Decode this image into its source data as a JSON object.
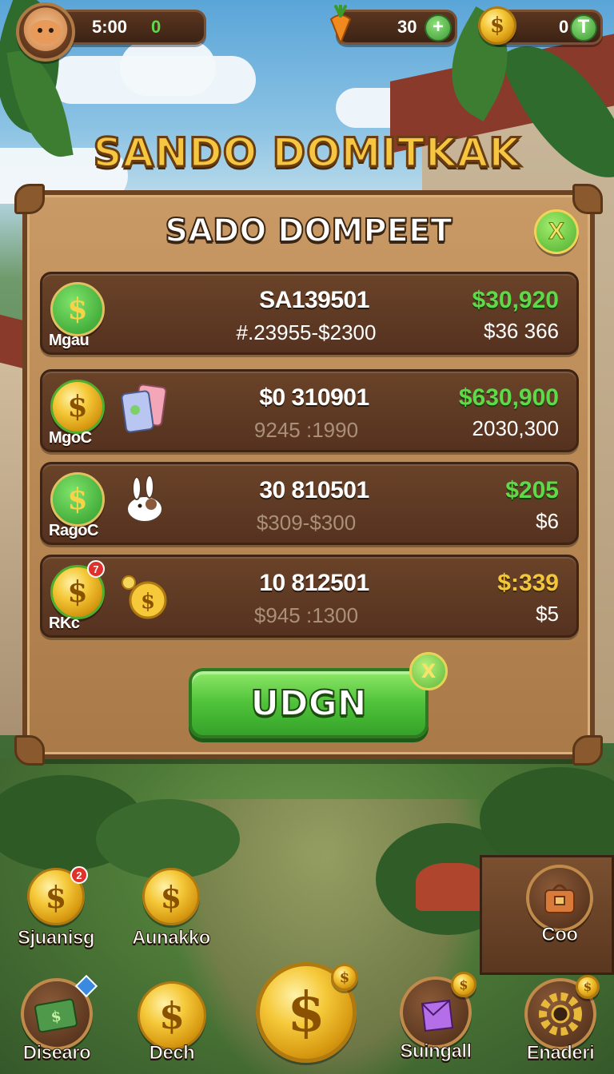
{
  "hud": {
    "timer": "5:00",
    "timer_count": "0",
    "carrots": "30",
    "coins": "0",
    "plus": "+",
    "t_plus": "T"
  },
  "title": "SANDO DOMITKAK",
  "panel": {
    "title": "SADO DOMPEET",
    "close_label": "X",
    "rows": [
      {
        "badge_symbol": "$",
        "badge_label": "Mgau",
        "code": "SA139501",
        "range": "#.23955-$2300",
        "price": "$30,920",
        "amount": "$36 366"
      },
      {
        "badge_symbol": "$",
        "badge_label": "MgoC",
        "code": "$0 310901",
        "range": "9245 :1990",
        "price": "$630,900",
        "amount": "2030,300"
      },
      {
        "badge_symbol": "$",
        "badge_label": "RagoC",
        "code": "30 810501",
        "range": "$309-$300",
        "price": "$205",
        "amount": "$6"
      },
      {
        "badge_symbol": "$",
        "badge_label": "RKc",
        "code": "10 812501",
        "range": "$945 :1300",
        "price": "$:339",
        "amount": "$5",
        "notification": "7"
      }
    ],
    "main_button": "UDGN",
    "main_button_sparkle": "X"
  },
  "nav": {
    "items": [
      {
        "label": "Sjuanisg",
        "symbol": "$",
        "badge": "2"
      },
      {
        "label": "Aunakko",
        "symbol": "$"
      },
      {
        "label": "Coo"
      },
      {
        "label": "Disearo"
      },
      {
        "label": "Dech",
        "symbol": "$"
      },
      {
        "label": "Suingall"
      },
      {
        "label": "Enaderi"
      }
    ],
    "center_symbol": "$"
  },
  "colors": {
    "price_green": "#5fd84a",
    "price_gold": "#f4c63c",
    "panel_wood": "#b98955",
    "button_green": "#4fc23a"
  }
}
